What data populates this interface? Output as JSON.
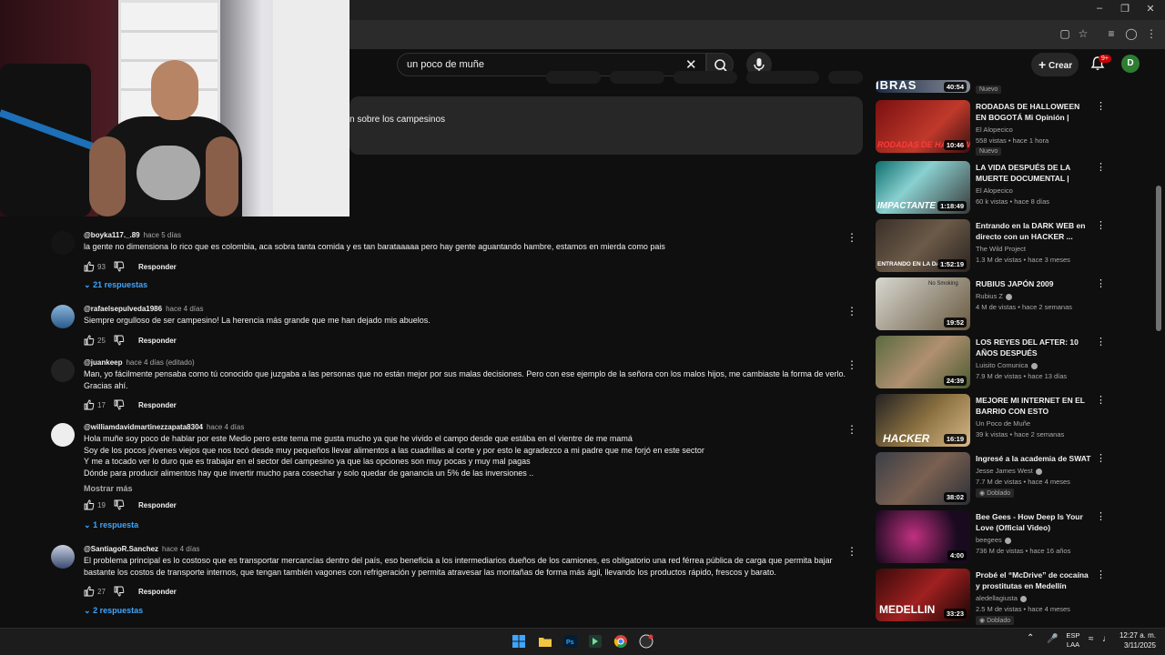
{
  "search": {
    "query": "un poco de muñe"
  },
  "header": {
    "create_label": "Crear",
    "notif_count": "9+",
    "avatar_letter": "D"
  },
  "description": {
    "snippet": "n sobre los campesinos"
  },
  "comments": [
    {
      "author": "@boyka117._.89",
      "time": "hace 5 días",
      "text": "la gente no dimensiona lo rico que es colombia, aca sobra tanta comida y es tan barataaaaa pero hay gente aguantando hambre, estamos en mierda como pais",
      "likes": "93",
      "reply_label": "Responder",
      "replies": "21 respuestas"
    },
    {
      "author": "@rafaelsepulveda1986",
      "time": "hace 4 días",
      "text": "Siempre orgulloso de ser campesino! La herencia más grande que me han dejado mis abuelos.",
      "likes": "25",
      "reply_label": "Responder"
    },
    {
      "author": "@juankeep",
      "time": "hace 4 días (editado)",
      "text": "Man, yo fácilmente pensaba como tú conocido que juzgaba a las personas que no están mejor por sus malas decisiones. Pero con ese ejemplo de la señora con los malos hijos, me cambiaste la forma de verlo. Gracias ahí.",
      "likes": "17",
      "reply_label": "Responder"
    },
    {
      "author": "@williamdavidmartinezzapata8304",
      "time": "hace 4 días",
      "lines": [
        "Hola muñe  soy poco de hablar por este Medio pero este tema me gusta mucho ya que he vivido el campo desde que estába en el vientre de me mamá",
        "Soy de los pocos jóvenes viejos  que nos tocó desde muy pequeños llevar alimentos  a las cuadrillas al corte  y por esto le agradezco a mi padre que me forjó en este sector",
        "Y me a tocado ver lo duro que es trabajar en el sector  del campesino ya que las opciones son muy pocas   y muy mal pagas",
        "Dónde para producir alimentos hay que invertir mucho para cosechar  y solo quedar de ganancia un 5% de las inversiones .."
      ],
      "more": "Mostrar más",
      "likes": "19",
      "reply_label": "Responder",
      "replies": "1 respuesta"
    },
    {
      "author": "@SantiagoR.Sanchez",
      "time": "hace 4 días",
      "text": "El problema principal es lo costoso que es transportar mercancías dentro del país, eso beneficia a los intermediarios dueños de los camiones, es obligatorio una red férrea pública de carga que permita bajar bastante los costos de transporte internos, que tengan también vagones con refrigeración y permita atravesar las montañas de forma más ágil, llevando los productos rápido, frescos y barato.",
      "likes": "27",
      "reply_label": "Responder",
      "replies": "2 respuestas"
    }
  ],
  "sidebar": [
    {
      "title": "",
      "channel": "",
      "meta": "",
      "badge": "Nuevo",
      "duration": "40:54",
      "thumb_text": "IBRAS",
      "color1": "#1b2a44",
      "color2": "#8a8f99"
    },
    {
      "title": "RODADAS DE HALLOWEEN EN BOGOTÁ Mi Opinión | MUÑE",
      "channel": "El Alopecico",
      "meta": "558 vistas • hace 1 hora",
      "badge": "Nuevo",
      "duration": "10:46",
      "thumb_text": "RODADAS DE HALLOW",
      "color1": "#7a1010",
      "color2": "#c0392b"
    },
    {
      "title": "LA VIDA DESPUÉS DE LA MUERTE DOCUMENTAL | MUÑE",
      "channel": "El Alopecico",
      "meta": "60 k vistas • hace 8 días",
      "duration": "1:18:49",
      "thumb_text": "IMPACTANTE",
      "color1": "#0d6e6e",
      "color2": "#3a3a3a"
    },
    {
      "title": "Entrando en la DARK WEB en directo con un HACKER ...",
      "channel": "The Wild Project",
      "meta": "1.3 M de vistas • hace 3 meses",
      "duration": "1:52:19",
      "thumb_text": "ENTRANDO EN LA DARK",
      "color1": "#3a3028",
      "color2": "#6b5a48"
    },
    {
      "title": "RUBIUS JAPÓN 2009",
      "channel": "Rubius Z",
      "verified": true,
      "meta": "4 M de vistas • hace 2 semanas",
      "duration": "19:52",
      "thumb_text": "No Smoking",
      "color1": "#d8d8d0",
      "color2": "#6a5a40"
    },
    {
      "title": "LOS REYES DEL AFTER: 10 AÑOS DESPUÉS",
      "channel": "Luisito Comunica",
      "verified": true,
      "meta": "7.9 M de vistas • hace 13 días",
      "duration": "24:39",
      "thumb_text": "",
      "color1": "#5a6a40",
      "color2": "#b09070"
    },
    {
      "title": "MEJORE MI INTERNET EN EL BARRIO CON ESTO anecdotas|...",
      "channel": "Un Poco de Muñe",
      "meta": "39 k vistas • hace 2 semanas",
      "duration": "16:19",
      "thumb_text": "HACKER",
      "color1": "#222222",
      "color2": "#8a7040"
    },
    {
      "title": "Ingresé a la academia de SWAT",
      "channel": "Jesse James West",
      "verified": true,
      "meta": "7.7 M de vistas • hace 4 meses",
      "badge": "Doblado",
      "duration": "38:02",
      "thumb_text": "",
      "color1": "#3a3f48",
      "color2": "#7a6050"
    },
    {
      "title": "Bee Gees - How Deep Is Your Love (Official Video)",
      "channel": "beegees",
      "verified": true,
      "meta": "736 M de vistas • hace 16 años",
      "duration": "4:00",
      "thumb_text": "",
      "color1": "#1a0a20",
      "color2": "#c03080"
    },
    {
      "title": "Probé el “McDrive” de cocaína y prostitutas en Medellín",
      "channel": "aledellagiusta",
      "verified": true,
      "meta": "2.5 M de vistas • hace 4 meses",
      "badge": "Doblado",
      "duration": "33:23",
      "thumb_text": "MEDELLIN",
      "color1": "#3a0a0a",
      "color2": "#a02020"
    }
  ],
  "taskbar": {
    "lang1": "ESP",
    "lang2": "LAA",
    "time": "12:27 a. m.",
    "date": "3/11/2025"
  }
}
